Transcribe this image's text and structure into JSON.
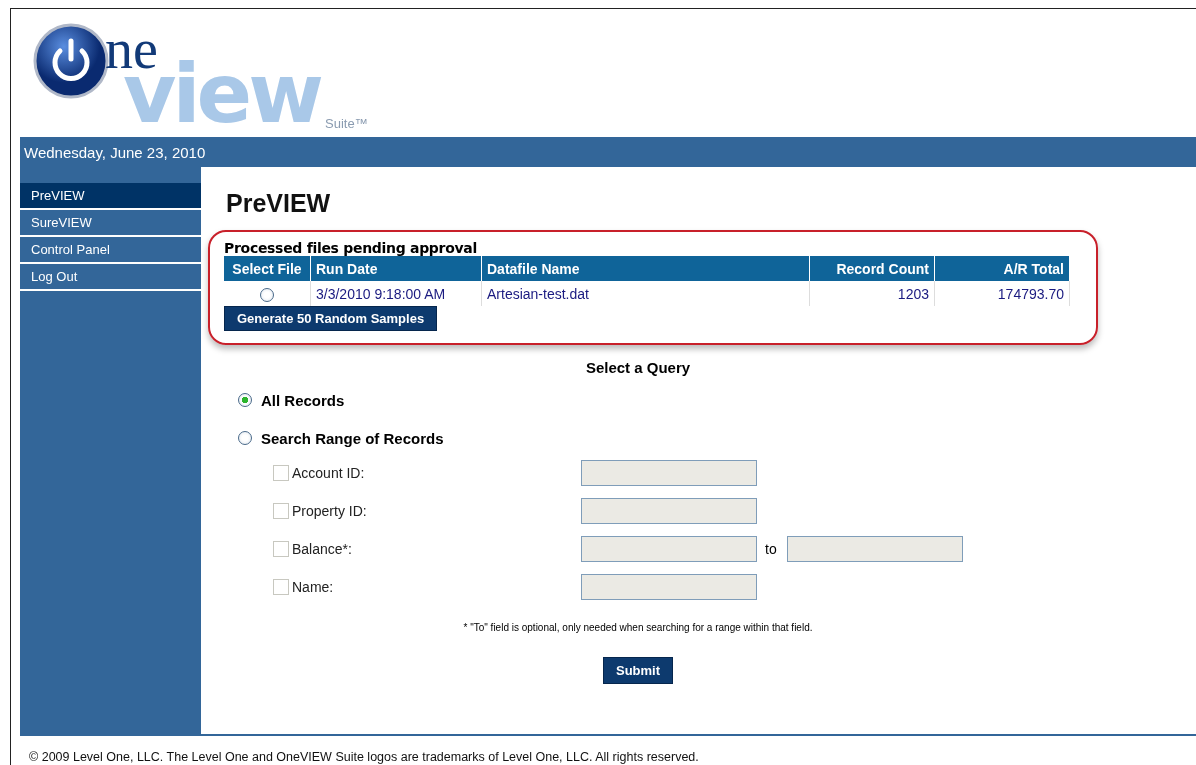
{
  "logo": {
    "word_1": "ne",
    "word_2": "view",
    "suffix": "Suite™"
  },
  "date": "Wednesday, June 23, 2010",
  "sidebar": {
    "items": [
      {
        "label": "PreVIEW",
        "selected": true
      },
      {
        "label": "SureVIEW",
        "selected": false
      },
      {
        "label": "Control Panel",
        "selected": false
      },
      {
        "label": "Log Out",
        "selected": false
      }
    ]
  },
  "page_title": "PreVIEW",
  "pending": {
    "title": "Processed files pending approval",
    "columns": [
      "Select File",
      "Run Date",
      "Datafile Name",
      "Record Count",
      "A/R Total"
    ],
    "rows": [
      {
        "selected": false,
        "run_date": "3/3/2010 9:18:00 AM",
        "datafile": "Artesian-test.dat",
        "record_count": "1203",
        "ar_total": "174793.70"
      }
    ],
    "button": "Generate 50 Random Samples"
  },
  "query": {
    "title": "Select a Query",
    "options": [
      {
        "label": "All Records",
        "selected": true
      },
      {
        "label": "Search Range of Records",
        "selected": false
      }
    ],
    "criteria": [
      {
        "label": "Account ID:",
        "checked": false,
        "kind": "single"
      },
      {
        "label": "Property ID:",
        "checked": false,
        "kind": "single"
      },
      {
        "label": "Balance*:",
        "checked": false,
        "kind": "range",
        "range_label": "to"
      },
      {
        "label": "Name:",
        "checked": false,
        "kind": "single"
      }
    ],
    "note": "* \"To\" field is optional, only needed when searching for a range within that field.",
    "submit": "Submit"
  },
  "footer": "© 2009 Level One, LLC. The Level One and OneVIEW Suite logos are trademarks of Level One, LLC. All rights reserved."
}
